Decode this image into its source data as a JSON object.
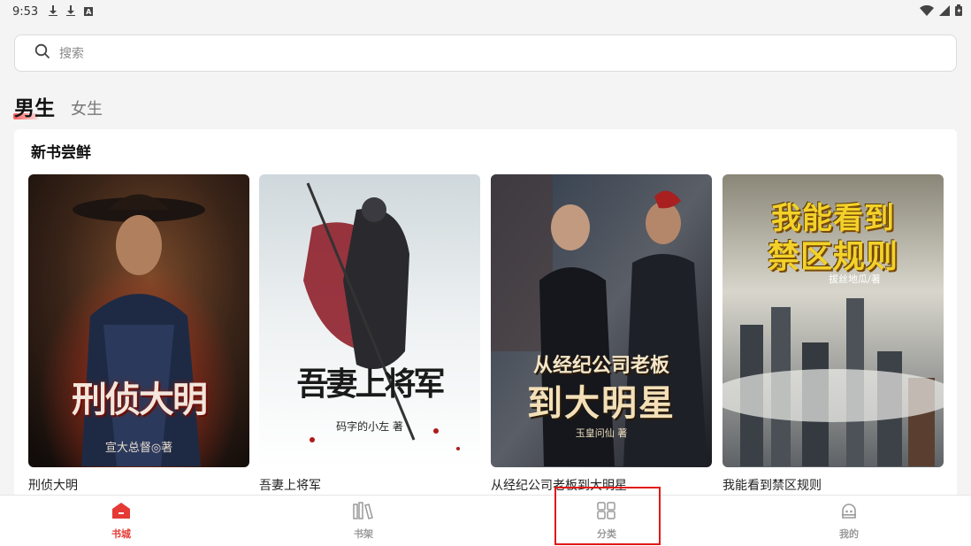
{
  "status_bar": {
    "time": "9:53",
    "icons": [
      "download-icon",
      "download-icon",
      "a-badge-icon",
      "wifi-icon",
      "signal-icon",
      "battery-icon"
    ]
  },
  "search": {
    "placeholder": "搜索"
  },
  "gender_tabs": {
    "male": "男生",
    "female": "女生",
    "active": "male"
  },
  "section": {
    "title": "新书尝鲜"
  },
  "books": [
    {
      "title": "刑侦大明",
      "cover_title": "刑侦大明",
      "cover_author": "宣大总督◎著"
    },
    {
      "title": "吾妻上将军",
      "cover_title": "吾妻上将军",
      "cover_author": "码字的小左 著"
    },
    {
      "title": "从经纪公司老板到大明星",
      "cover_title_line1": "从经纪公司老板",
      "cover_title_line2": "到大明星",
      "cover_author": "玉皇问仙 著"
    },
    {
      "title": "我能看到禁区规则",
      "cover_title_line1": "我能看到",
      "cover_title_line2": "禁区规则",
      "cover_author": "拔丝地瓜/著"
    }
  ],
  "bottom_nav": {
    "items": [
      {
        "label": "书城",
        "icon": "home-icon",
        "active": true
      },
      {
        "label": "书架",
        "icon": "bookshelf-icon",
        "active": false
      },
      {
        "label": "分类",
        "icon": "category-grid-icon",
        "active": false
      },
      {
        "label": "我的",
        "icon": "profile-icon",
        "active": false
      }
    ]
  },
  "colors": {
    "accent": "#e53935",
    "highlight": "#e01919",
    "inactive": "#9a9a9a"
  }
}
